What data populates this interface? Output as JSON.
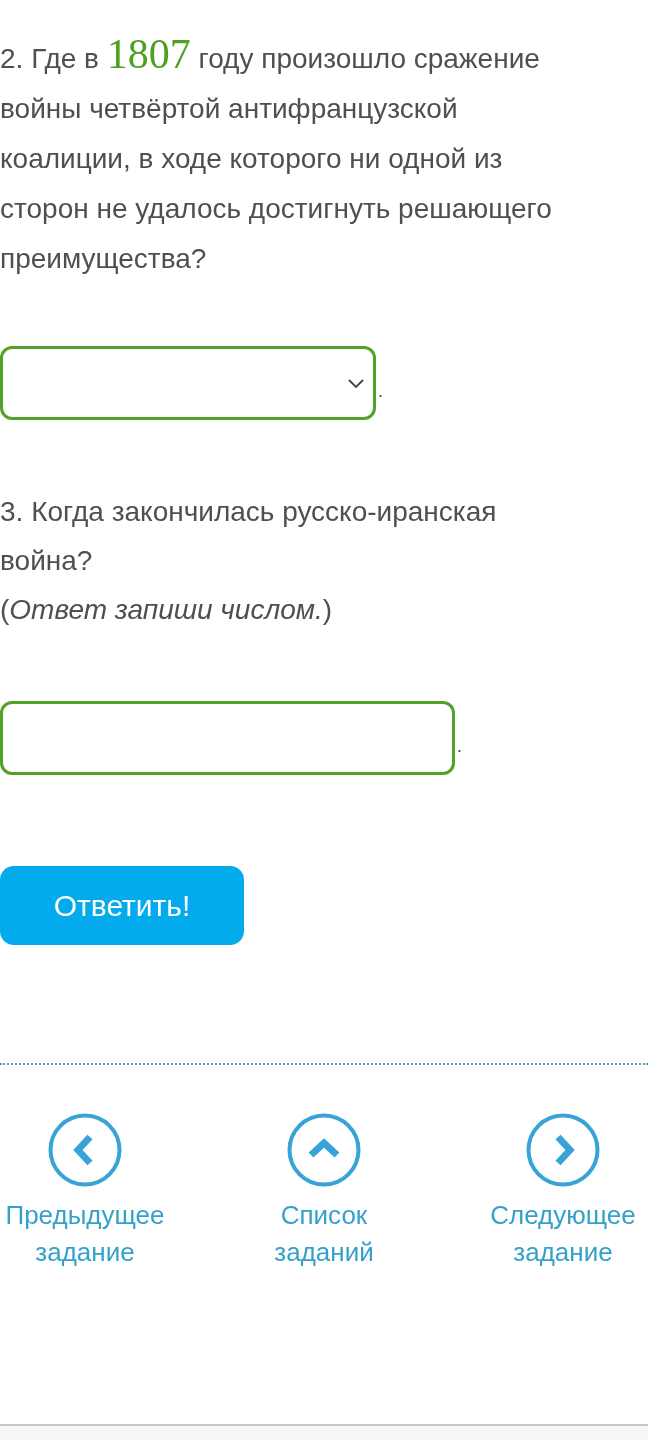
{
  "questions": [
    {
      "text_parts": [
        {
          "kind": "plain",
          "text": "2. Где в "
        },
        {
          "kind": "highlight",
          "text": "1807"
        },
        {
          "kind": "plain",
          "text": " году произошло сражение войны четвёртой антифранцузской коалиции, в ходе которого ни одной из сторон не удалось достигнуть решающего преимущества?"
        }
      ],
      "answer": {
        "kind": "select",
        "suffix": "."
      }
    },
    {
      "text_parts": [
        {
          "kind": "plain",
          "text": "3. Когда закончилась русско-иранская война?"
        }
      ],
      "hint": "(*Ответ запиши числом.*)",
      "answer": {
        "kind": "text",
        "suffix": "."
      }
    }
  ],
  "submit_button": {
    "label": "Ответить!"
  },
  "navigation": [
    {
      "kind": "previous",
      "label": "Предыдущее задание"
    },
    {
      "kind": "list",
      "label": "Список заданий"
    },
    {
      "kind": "next",
      "label": "Следующее задание"
    }
  ]
}
